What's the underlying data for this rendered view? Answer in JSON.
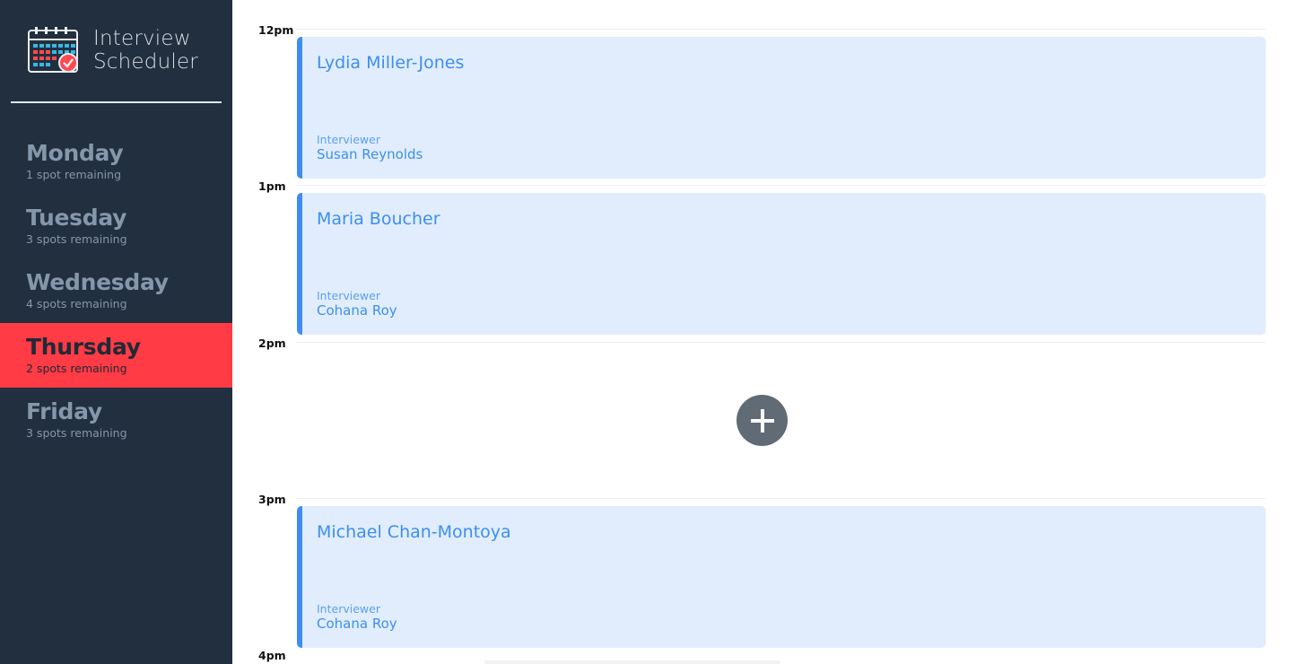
{
  "app": {
    "title_line1": "Interview",
    "title_line2": "Scheduler",
    "logo_icon": "calendar-check-icon"
  },
  "days": [
    {
      "name": "Monday",
      "spots": "1 spot remaining",
      "selected": false
    },
    {
      "name": "Tuesday",
      "spots": "3 spots remaining",
      "selected": false
    },
    {
      "name": "Wednesday",
      "spots": "4 spots remaining",
      "selected": false
    },
    {
      "name": "Thursday",
      "spots": "2 spots remaining",
      "selected": true
    },
    {
      "name": "Friday",
      "spots": "3 spots remaining",
      "selected": false
    }
  ],
  "times": [
    "12pm",
    "1pm",
    "2pm",
    "3pm",
    "4pm"
  ],
  "appointments": [
    {
      "student": "Lydia Miller-Jones",
      "interviewer_label": "Interviewer",
      "interviewer": "Susan Reynolds"
    },
    {
      "student": "Maria Boucher",
      "interviewer_label": "Interviewer",
      "interviewer": "Cohana Roy"
    },
    {
      "student": "Michael Chan-Montoya",
      "interviewer_label": "Interviewer",
      "interviewer": "Cohana Roy"
    }
  ],
  "empty_slot": {
    "icon": "plus-icon"
  },
  "colors": {
    "sidebar_bg": "#222f3e",
    "selected_day": "#ff3b45",
    "appointment_bg": "#e1edfd",
    "accent_blue": "#3d8ef0",
    "add_button": "#616b76"
  }
}
